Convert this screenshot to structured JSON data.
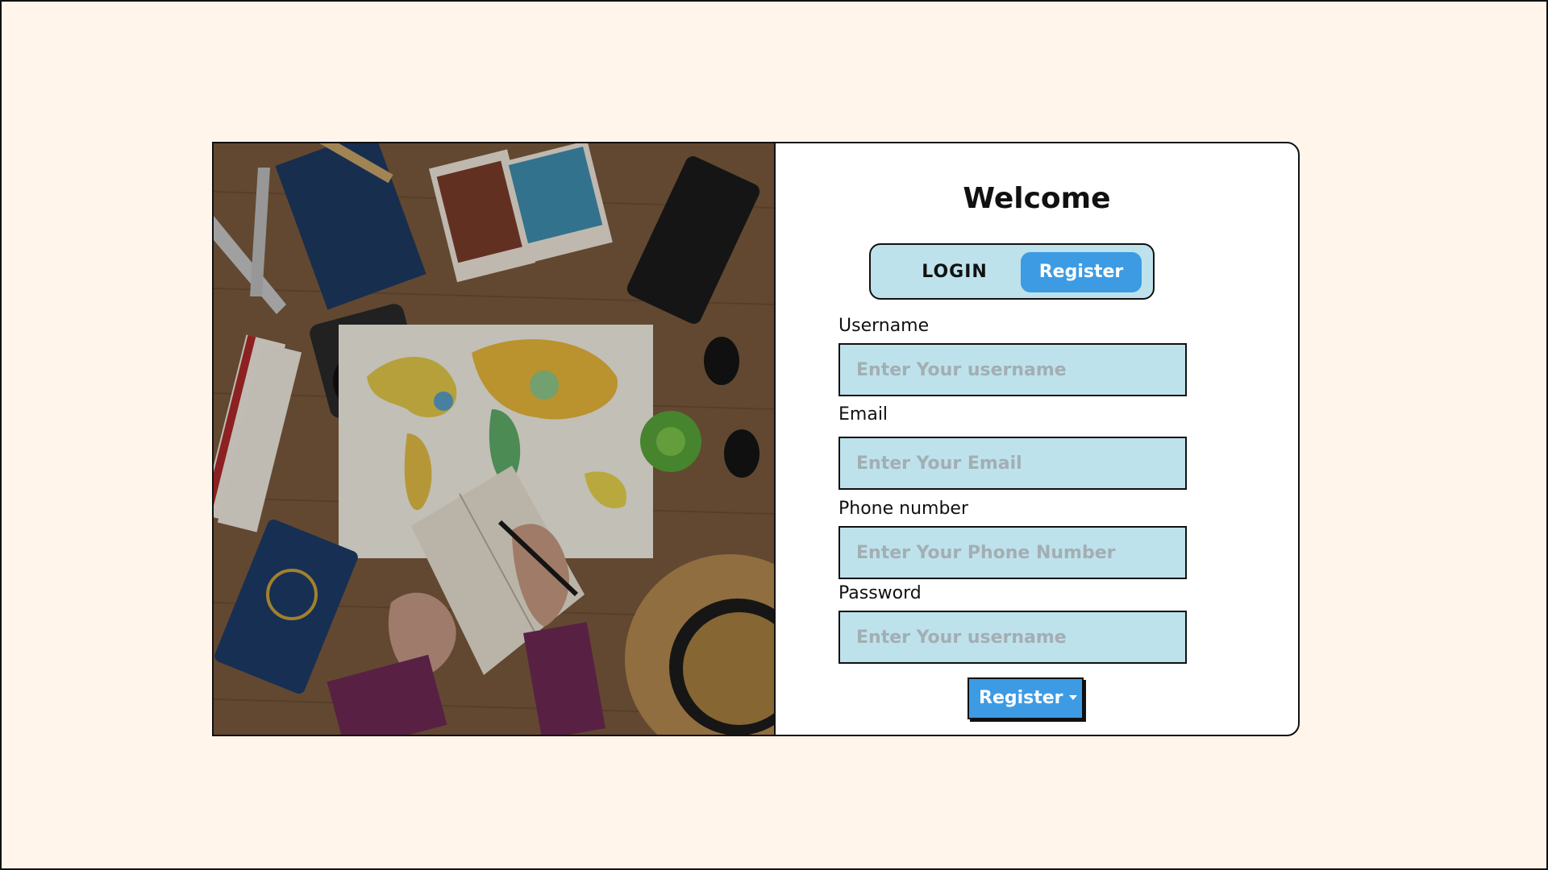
{
  "form": {
    "title": "Welcome",
    "tabs": {
      "login": "LOGIN",
      "register": "Register"
    },
    "fields": [
      {
        "label": "Username",
        "placeholder": "Enter Your username"
      },
      {
        "label": "Email",
        "placeholder": "Enter Your Email"
      },
      {
        "label": "Phone number",
        "placeholder": "Enter Your Phone Number"
      },
      {
        "label": "Password",
        "placeholder": "Enter Your username"
      }
    ],
    "submit_label": "Register"
  },
  "colors": {
    "page_background": "#fff5ea",
    "accent": "#3d9be3",
    "input_background": "#bde2ec"
  },
  "image": {
    "subject": "travel flat-lay photo: world map, passports, camera, notebook, hat, sunglasses, photos, toy airplane on wooden table"
  }
}
